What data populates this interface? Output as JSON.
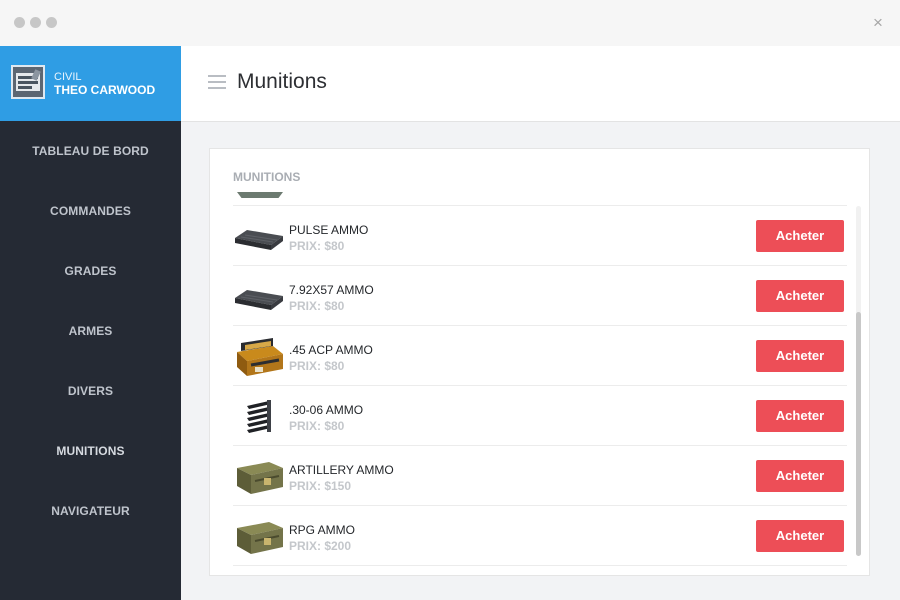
{
  "window": {
    "close_glyph": "×"
  },
  "sidebar": {
    "profile": {
      "role": "CIVIL",
      "name": "THEO CARWOOD"
    },
    "items": [
      {
        "label": "TABLEAU DE BORD"
      },
      {
        "label": "COMMANDES"
      },
      {
        "label": "GRADES"
      },
      {
        "label": "ARMES"
      },
      {
        "label": "DIVERS"
      },
      {
        "label": "MUNITIONS"
      },
      {
        "label": "NAVIGATEUR"
      }
    ]
  },
  "header": {
    "title": "Munitions"
  },
  "panel": {
    "heading": "MUNITIONS",
    "items": [
      {
        "name": "PULSE AMMO",
        "price": "PRIX: $80",
        "button": "Acheter",
        "icon": "ammo-crate-flat-icon"
      },
      {
        "name": "7.92X57 AMMO",
        "price": "PRIX: $80",
        "button": "Acheter",
        "icon": "ammo-crate-flat-icon"
      },
      {
        "name": ".45 ACP AMMO",
        "price": "PRIX: $80",
        "button": "Acheter",
        "icon": "ammo-box-open-icon"
      },
      {
        "name": ".30-06 AMMO",
        "price": "PRIX: $80",
        "button": "Acheter",
        "icon": "stripper-clip-icon"
      },
      {
        "name": "ARTILLERY AMMO",
        "price": "PRIX: $150",
        "button": "Acheter",
        "icon": "military-crate-icon"
      },
      {
        "name": "RPG AMMO",
        "price": "PRIX: $200",
        "button": "Acheter",
        "icon": "military-crate-icon"
      }
    ]
  },
  "colors": {
    "accent": "#2f9de4",
    "sidebar_bg": "#252a34",
    "buy_button": "#ed4e57"
  }
}
